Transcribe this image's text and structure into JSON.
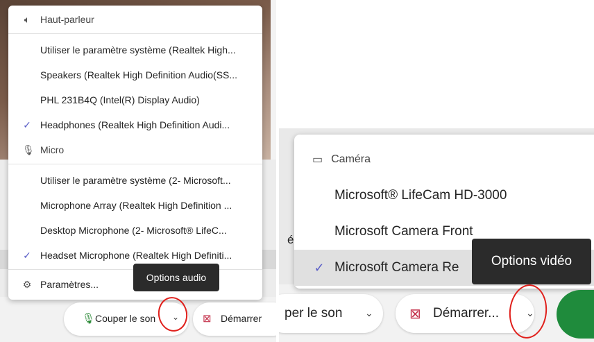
{
  "audio_menu": {
    "speaker_header": "Haut-parleur",
    "speakers": [
      {
        "label": "Utiliser le paramètre système (Realtek High...",
        "checked": false
      },
      {
        "label": "Speakers (Realtek High Definition Audio(SS...",
        "checked": false
      },
      {
        "label": "PHL 231B4Q (Intel(R) Display Audio)",
        "checked": false
      },
      {
        "label": "Headphones (Realtek High Definition Audi...",
        "checked": true
      }
    ],
    "mic_header": "Micro",
    "mics": [
      {
        "label": "Utiliser le paramètre système (2- Microsoft...",
        "checked": false
      },
      {
        "label": "Microphone Array (Realtek High Definition ...",
        "checked": false
      },
      {
        "label": "Desktop Microphone (2- Microsoft® LifeC...",
        "checked": false
      },
      {
        "label": "Headset Microphone (Realtek High Definiti...",
        "checked": true
      }
    ],
    "settings_label": "Paramètres..."
  },
  "tooltips": {
    "audio": "Options audio",
    "video": "Options vidéo"
  },
  "left_controls": {
    "mute_label": "Couper le son",
    "video_label": "Démarrer"
  },
  "video_menu": {
    "header": "Caméra",
    "cameras": [
      {
        "label": "Microsoft® LifeCam HD-3000",
        "checked": false
      },
      {
        "label": "Microsoft Camera Front",
        "checked": false
      },
      {
        "label": "Microsoft Camera Re",
        "checked": true
      }
    ]
  },
  "right_controls": {
    "mute_label": "per le son",
    "video_label": "Démarrer...",
    "stray_text": "é"
  },
  "colors": {
    "check": "#5b5fc7",
    "mic_active": "#2e8b3a",
    "camera_off": "#c4314b",
    "annotation": "#e0201c",
    "join_button": "#1f8b3c"
  },
  "icons": {
    "speaker": "speaker-icon",
    "mic": "mic-icon",
    "camera": "camera-icon",
    "settings": "gear-icon",
    "check": "checkmark-icon",
    "dropdown": "chevron-down-icon"
  }
}
